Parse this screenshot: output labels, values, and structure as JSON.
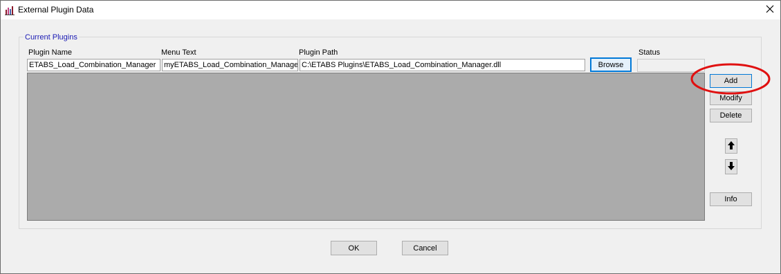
{
  "window": {
    "title": "External Plugin Data"
  },
  "group": {
    "legend": "Current Plugins"
  },
  "columns": {
    "plugin_name": "Plugin Name",
    "menu_text": "Menu Text",
    "plugin_path": "Plugin Path",
    "status": "Status"
  },
  "fields": {
    "plugin_name_value": "ETABS_Load_Combination_Manager",
    "menu_text_value": "myETABS_Load_Combination_Manager",
    "plugin_path_value": "C:\\ETABS Plugins\\ETABS_Load_Combination_Manager.dll",
    "status_value": ""
  },
  "buttons": {
    "browse": "Browse",
    "add": "Add",
    "modify": "Modify",
    "delete": "Delete",
    "info": "Info",
    "ok": "OK",
    "cancel": "Cancel"
  },
  "icons": {
    "app": "app-chart-icon",
    "close": "close-icon",
    "move_up": "arrow-up-icon",
    "move_down": "arrow-down-icon"
  },
  "colors": {
    "legend_text": "#1a1ab4",
    "highlight_annotation": "#e01010",
    "grid_background": "#ababab",
    "focus_border": "#0078d7"
  }
}
